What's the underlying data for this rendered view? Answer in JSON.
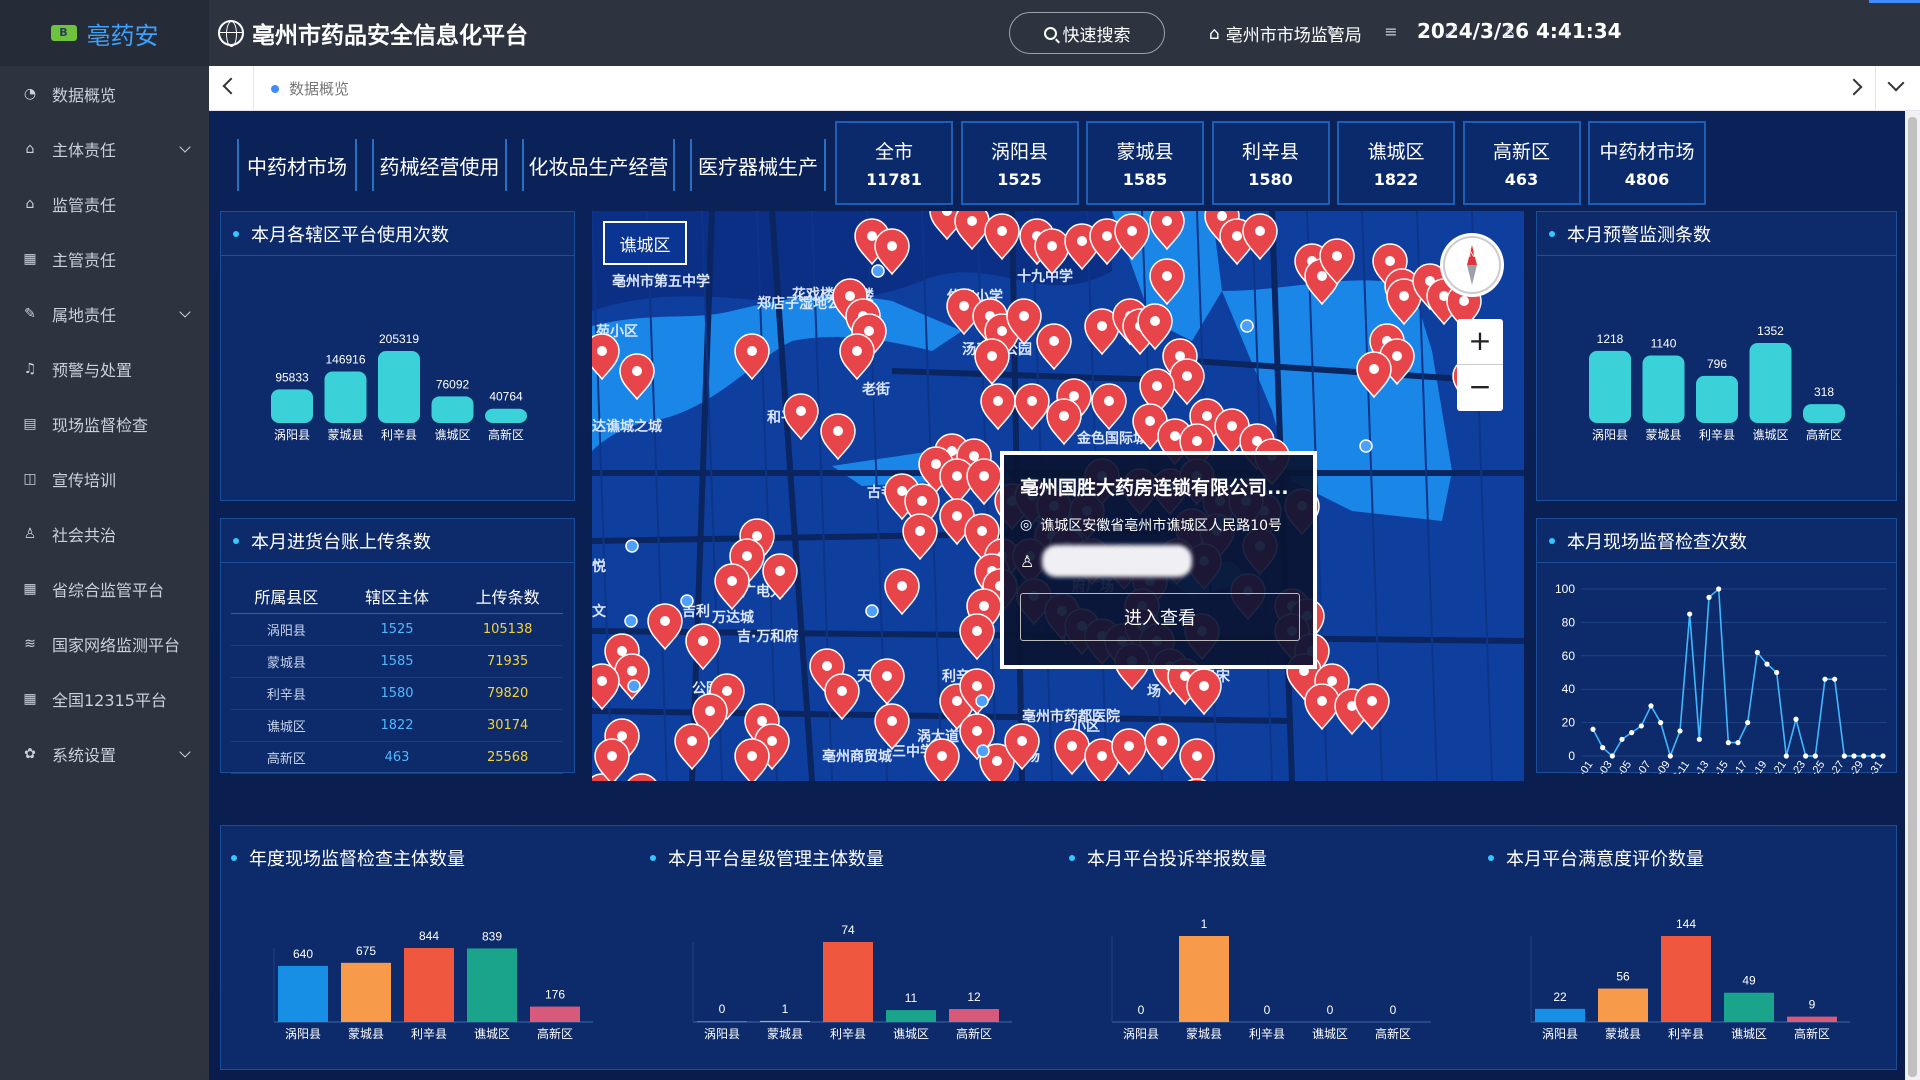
{
  "app": {
    "logo_text": "亳药安",
    "title": "亳州市药品安全信息化平台"
  },
  "header": {
    "search_label": "快速搜索",
    "org": "亳州市市场监管局",
    "datetime": "2024/3/26 4:41:34"
  },
  "sidebar": {
    "items": [
      {
        "label": "数据概览",
        "icon": "dashboard-icon",
        "expand": false
      },
      {
        "label": "主体责任",
        "icon": "home-icon",
        "expand": true
      },
      {
        "label": "监管责任",
        "icon": "home-icon",
        "expand": false
      },
      {
        "label": "主管责任",
        "icon": "building-icon",
        "expand": false
      },
      {
        "label": "属地责任",
        "icon": "document-edit-icon",
        "expand": true
      },
      {
        "label": "预警与处置",
        "icon": "bell-icon",
        "expand": false
      },
      {
        "label": "现场监督检查",
        "icon": "calendar-icon",
        "expand": false
      },
      {
        "label": "宣传培训",
        "icon": "book-icon",
        "expand": false
      },
      {
        "label": "社会共治",
        "icon": "user-icon",
        "expand": false
      },
      {
        "label": "省综合监管平台",
        "icon": "building-icon",
        "expand": false
      },
      {
        "label": "国家网络监测平台",
        "icon": "rss-icon",
        "expand": false
      },
      {
        "label": "全国12315平台",
        "icon": "building-icon",
        "expand": false
      },
      {
        "label": "系统设置",
        "icon": "gear-icon",
        "expand": true
      }
    ]
  },
  "tabbar": {
    "active_tab": "数据概览"
  },
  "categories": [
    "中药材市场",
    "药械经营使用",
    "化妆品生产经营",
    "医疗器械生产"
  ],
  "region_counts": [
    {
      "name": "全市",
      "value": "11781"
    },
    {
      "name": "涡阳县",
      "value": "1525"
    },
    {
      "name": "蒙城县",
      "value": "1585"
    },
    {
      "name": "利辛县",
      "value": "1580"
    },
    {
      "name": "谯城区",
      "value": "1822"
    },
    {
      "name": "高新区",
      "value": "463"
    },
    {
      "name": "中药材市场",
      "value": "4806"
    }
  ],
  "panels": {
    "usage_title": "本月各辖区平台使用次数",
    "upload_title": "本月进货台账上传条数",
    "warning_title": "本月预警监测条数",
    "inspect_title": "本月现场监督检查次数",
    "annual_title": "年度现场监督检查主体数量",
    "star_title": "本月平台星级管理主体数量",
    "complaint_title": "本月平台投诉举报数量",
    "satisfaction_title": "本月平台满意度评价数量"
  },
  "upload_table": {
    "headers": [
      "所属县区",
      "辖区主体",
      "上传条数"
    ],
    "rows": [
      [
        "涡阳县",
        "1525",
        "105138"
      ],
      [
        "蒙城县",
        "1585",
        "71935"
      ],
      [
        "利辛县",
        "1580",
        "79820"
      ],
      [
        "谯城区",
        "1822",
        "30174"
      ],
      [
        "高新区",
        "463",
        "25568"
      ]
    ]
  },
  "map": {
    "region_label": "谯城区",
    "popup_title": "亳州国胜大药房连锁有限公司...",
    "popup_address": "谯城区安徽省亳州市谯城区人民路10号",
    "popup_button": "进入查看",
    "place_labels": [
      "亳州市第五中学",
      "郑店子湿地公园",
      "花戏楼小区",
      "花戏楼",
      "佑农小学",
      "十九中学",
      "汤王陵公园",
      "和平路",
      "老街",
      "金色国际城",
      "古寺",
      "中医院",
      "涡",
      "广电大",
      "万达城",
      "吉·万和府",
      "天",
      "(涉王大道)",
      "利辛路",
      "亳州商贸城",
      "亳州市药都医院",
      "云宋",
      "三中学",
      "市场",
      "涡大道",
      "场",
      "湖",
      "苑小区",
      "达谯城之城",
      "悦",
      "文",
      "石府",
      "吉利",
      "公园",
      "府广场",
      "小区"
    ]
  },
  "colors": {
    "bar_primary": "#3ad1d8",
    "orange": "#f79a4a",
    "red": "#f0573f",
    "blue": "#168fe4",
    "teal": "#1aa48b",
    "pink": "#d85a7a",
    "pin": "#e8454b"
  },
  "chart_data": [
    {
      "id": "usage",
      "type": "bar",
      "title": "本月各辖区平台使用次数",
      "categories": [
        "涡阳县",
        "蒙城县",
        "利辛县",
        "谯城区",
        "高新区"
      ],
      "values": [
        95833,
        146916,
        205319,
        76092,
        40764
      ]
    },
    {
      "id": "warning",
      "type": "bar",
      "title": "本月预警监测条数",
      "categories": [
        "涡阳县",
        "蒙城县",
        "利辛县",
        "谯城区",
        "高新区"
      ],
      "values": [
        1218,
        1140,
        796,
        1352,
        318
      ]
    },
    {
      "id": "inspect",
      "type": "line",
      "title": "本月现场监督检查次数",
      "x": [
        "03-01",
        "03-03",
        "03-05",
        "03-07",
        "03-09",
        "03-11",
        "03-13",
        "03-15",
        "03-17",
        "03-19",
        "03-21",
        "03-23",
        "03-25",
        "03-27",
        "03-29",
        "03-31"
      ],
      "ylim": [
        0,
        100
      ],
      "yticks": [
        0,
        20,
        40,
        60,
        80,
        100
      ],
      "values": [
        16,
        5,
        0,
        10,
        14,
        18,
        30,
        20,
        0,
        15,
        85,
        10,
        95,
        100,
        8,
        8,
        20,
        62,
        55,
        50,
        0,
        22,
        0,
        0,
        46,
        46,
        0,
        0,
        0,
        0,
        0
      ]
    },
    {
      "id": "annual",
      "type": "bar",
      "title": "年度现场监督检查主体数量",
      "categories": [
        "涡阳县",
        "蒙城县",
        "利辛县",
        "谯城区",
        "高新区"
      ],
      "values": [
        640,
        675,
        844,
        839,
        176
      ]
    },
    {
      "id": "star",
      "type": "bar",
      "title": "本月平台星级管理主体数量",
      "categories": [
        "涡阳县",
        "蒙城县",
        "利辛县",
        "谯城区",
        "高新区"
      ],
      "values": [
        0,
        1,
        74,
        11,
        12
      ]
    },
    {
      "id": "complaint",
      "type": "bar",
      "title": "本月平台投诉举报数量",
      "categories": [
        "涡阳县",
        "蒙城县",
        "利辛县",
        "谯城区",
        "高新区"
      ],
      "values": [
        0,
        1,
        0,
        0,
        0
      ]
    },
    {
      "id": "satisfaction",
      "type": "bar",
      "title": "本月平台满意度评价数量",
      "categories": [
        "涡阳县",
        "蒙城县",
        "利辛县",
        "谯城区",
        "高新区"
      ],
      "values": [
        22,
        56,
        144,
        49,
        9
      ]
    }
  ]
}
